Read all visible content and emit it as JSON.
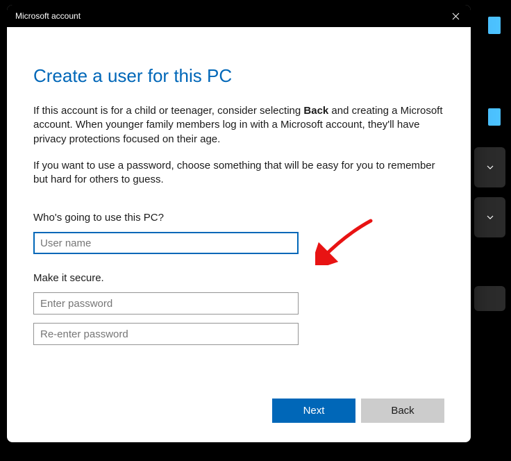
{
  "titlebar": {
    "title": "Microsoft account"
  },
  "content": {
    "heading": "Create a user for this PC",
    "desc1_pre": "If this account is for a child or teenager, consider selecting ",
    "desc1_bold": "Back",
    "desc1_post": " and creating a Microsoft account. When younger family members log in with a Microsoft account, they'll have privacy protections focused on their age.",
    "desc2": "If you want to use a password, choose something that will be easy for you to remember but hard for others to guess.",
    "section_user": "Who's going to use this PC?",
    "username_placeholder": "User name",
    "section_password": "Make it secure.",
    "password_placeholder": "Enter password",
    "password2_placeholder": "Re-enter password"
  },
  "buttons": {
    "next": "Next",
    "back": "Back"
  },
  "colors": {
    "primary": "#0067b8",
    "accent": "#4cc2ff",
    "annotation": "#e81313"
  }
}
